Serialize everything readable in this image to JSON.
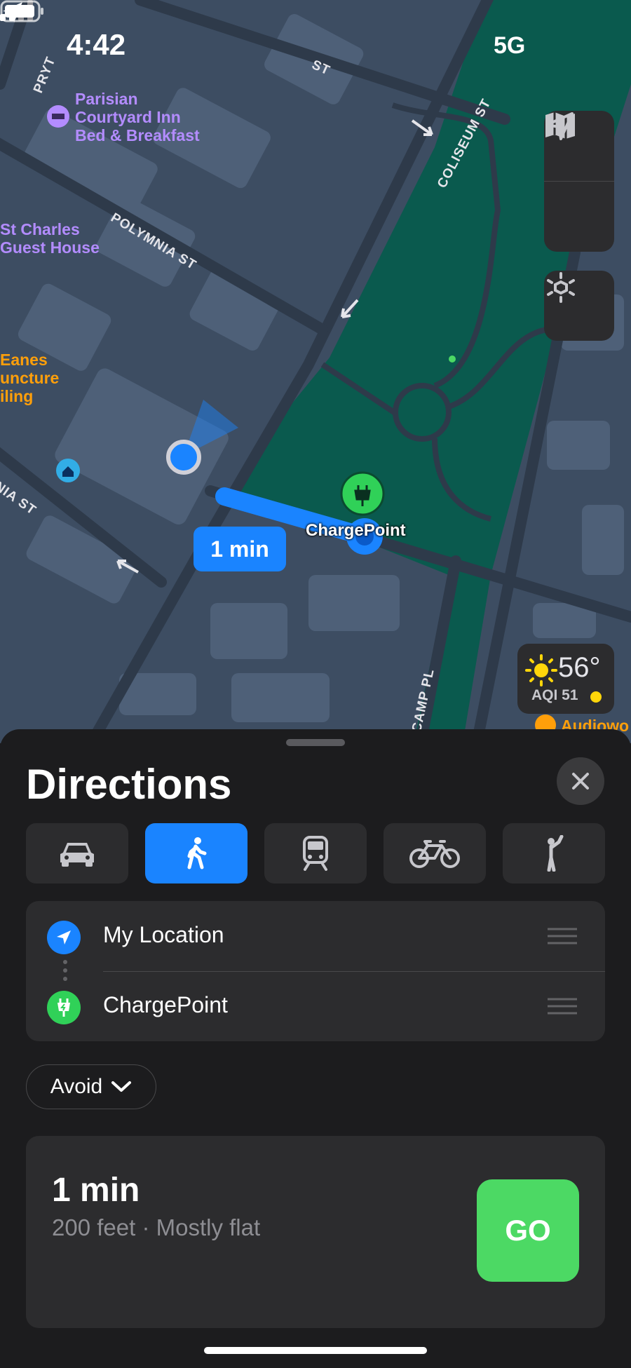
{
  "status_bar": {
    "time": "4:42",
    "network": "5G"
  },
  "map": {
    "pois": [
      {
        "name": "Parisian Courtyard Inn Bed & Breakfast",
        "lines": [
          "Parisian",
          "Courtyard Inn",
          "Bed & Breakfast"
        ],
        "color": "#b38cff",
        "icon": "bed-icon"
      },
      {
        "name": "St Charles Guest House",
        "lines": [
          "St Charles",
          "Guest House"
        ],
        "color": "#b38cff"
      },
      {
        "name": "Eanes Juncture Ceiling (partial)",
        "lines": [
          "Eanes",
          "uncture",
          "iling"
        ],
        "color": "#ff9f0a"
      },
      {
        "name": "Audiowo (partial)",
        "lines": [
          "Audiowo"
        ],
        "color": "#ff9f0a",
        "icon": "briefcase-icon"
      }
    ],
    "streets": [
      "PRYT",
      "ST",
      "COLISEUM ST",
      "POLYMNIA ST",
      "NIA ST",
      "CAMP PL"
    ],
    "route_time_label": "1 min",
    "destination_label": "ChargePoint",
    "weather": {
      "temperature": "56°",
      "aqi": "AQI 51",
      "aqi_color": "#ffd60a",
      "icon": "sun-icon"
    },
    "controls": [
      "map-icon",
      "location-arrow-icon",
      "3d-view-icon"
    ]
  },
  "sheet": {
    "title": "Directions",
    "close_icon": "close-icon",
    "modes": [
      {
        "name": "drive",
        "icon": "car-icon",
        "active": false
      },
      {
        "name": "walk",
        "icon": "walk-icon",
        "active": true
      },
      {
        "name": "transit",
        "icon": "train-icon",
        "active": false
      },
      {
        "name": "cycle",
        "icon": "bicycle-icon",
        "active": false
      },
      {
        "name": "ride",
        "icon": "hail-icon",
        "active": false
      }
    ],
    "route": {
      "from": "My Location",
      "to": "ChargePoint"
    },
    "avoid_label": "Avoid",
    "summary": {
      "time": "1 min",
      "details": "200 feet · Mostly flat",
      "go_label": "GO"
    }
  },
  "colors": {
    "accent": "#1a84ff",
    "go": "#4cd964",
    "park": "#0a5a4e",
    "charge_icon": "#30d158"
  }
}
